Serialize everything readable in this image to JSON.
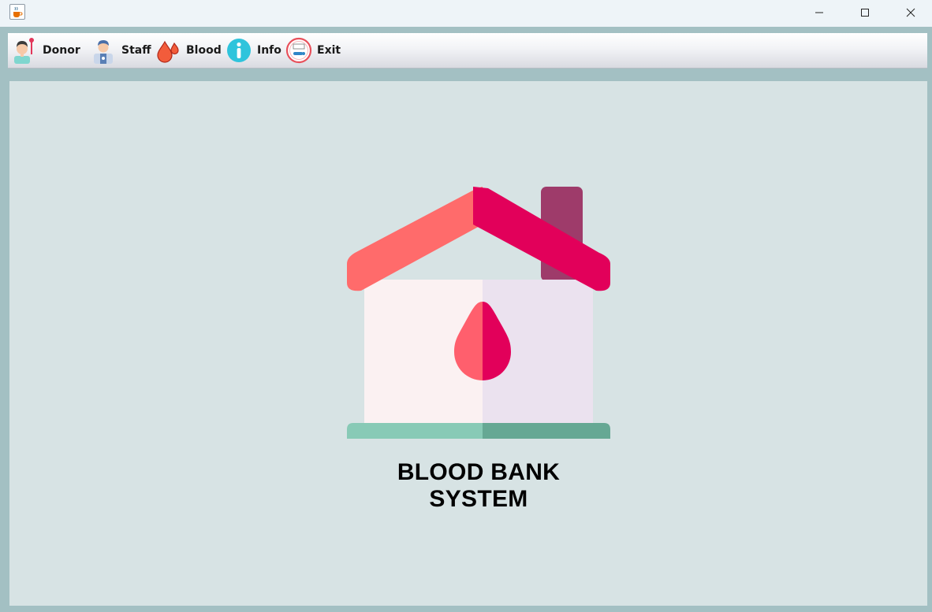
{
  "window": {
    "app_icon": "java-cup-icon",
    "controls": [
      "minimize-icon",
      "maximize-icon",
      "close-icon"
    ]
  },
  "menu": {
    "items": [
      {
        "label": "Donor",
        "icon": "donor-icon"
      },
      {
        "label": "Staff",
        "icon": "staff-icon"
      },
      {
        "label": "Blood",
        "icon": "blood-drops-icon"
      },
      {
        "label": "Info",
        "icon": "info-icon"
      },
      {
        "label": "Exit",
        "icon": "exit-icon"
      }
    ]
  },
  "main": {
    "logo_icon": "blood-bank-house-icon",
    "title": "BLOOD BANK SYSTEM"
  },
  "colors": {
    "frame": "#a3c0c3",
    "content_bg": "#d7e3e4",
    "roof_left": "#ff6b6b",
    "roof_right": "#e2005a",
    "chimney": "#9e3b6a",
    "drop_left": "#ff5f6d",
    "drop_right": "#e2005a",
    "base_left": "#88cab6",
    "base_right": "#66a894"
  }
}
